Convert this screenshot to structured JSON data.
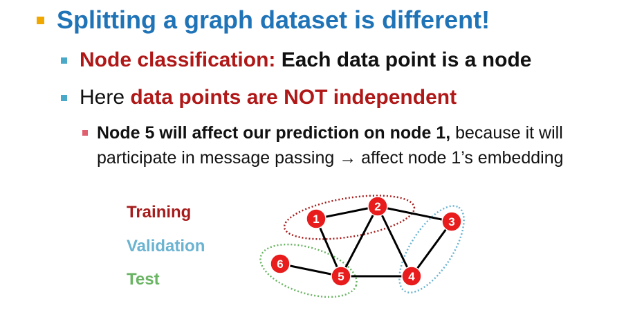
{
  "heading": "Splitting a graph dataset is different!",
  "bullet_node_classification": {
    "label": "Node classification:",
    "text": " Each data point is a node"
  },
  "bullet_not_independent": {
    "prefix": "Here ",
    "emphasis": "data points are NOT independent"
  },
  "sub_bullet": {
    "bold": "Node 5 will affect our prediction on node 1,",
    "line1_rest": " because it will",
    "line2_before_arrow": "participate in message passing ",
    "arrow": "→",
    "line2_after_arrow": " affect node 1’s embedding"
  },
  "legend": {
    "training": "Training",
    "validation": "Validation",
    "test": "Test"
  },
  "graph": {
    "nodes": [
      "1",
      "2",
      "3",
      "4",
      "5",
      "6"
    ],
    "edges": [
      [
        "1",
        "2"
      ],
      [
        "2",
        "3"
      ],
      [
        "1",
        "5"
      ],
      [
        "2",
        "5"
      ],
      [
        "2",
        "4"
      ],
      [
        "5",
        "4"
      ],
      [
        "6",
        "5"
      ],
      [
        "3",
        "4"
      ]
    ],
    "splits": {
      "training": [
        "1",
        "2"
      ],
      "validation": [
        "3",
        "4"
      ],
      "test": [
        "5",
        "6"
      ]
    }
  },
  "colors": {
    "heading": "#1f73b7",
    "emphasis_red": "#b01818",
    "node_fill": "#e81c1c",
    "training": "#a61c1c",
    "validation": "#6ab3d1",
    "test": "#6ab563",
    "bullet_lvl1": "#f0a800",
    "bullet_lvl2": "#4aa9c8",
    "bullet_lvl3": "#e06070"
  }
}
